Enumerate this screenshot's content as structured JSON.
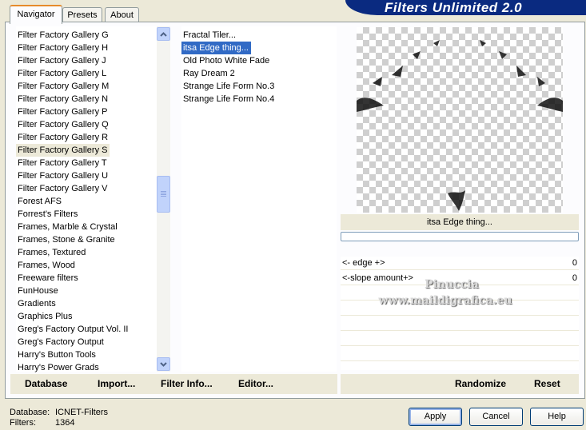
{
  "banner": {
    "title": "Filters Unlimited 2.0"
  },
  "tabs": [
    {
      "label": "Navigator",
      "active": true
    },
    {
      "label": "Presets",
      "active": false
    },
    {
      "label": "About",
      "active": false
    }
  ],
  "categories": {
    "items": [
      "Filter Factory Gallery G",
      "Filter Factory Gallery H",
      "Filter Factory Gallery J",
      "Filter Factory Gallery L",
      "Filter Factory Gallery M",
      "Filter Factory Gallery N",
      "Filter Factory Gallery P",
      "Filter Factory Gallery Q",
      "Filter Factory Gallery R",
      "Filter Factory Gallery S",
      "Filter Factory Gallery T",
      "Filter Factory Gallery U",
      "Filter Factory Gallery V",
      "Forest AFS",
      "Forrest's Filters",
      "Frames, Marble & Crystal",
      "Frames, Stone & Granite",
      "Frames, Textured",
      "Frames, Wood",
      "Freeware filters",
      "FunHouse",
      "Gradients",
      "Graphics Plus",
      "Greg's Factory Output Vol. II",
      "Greg's Factory Output",
      "Harry's Button Tools",
      "Harry's Power Grads"
    ],
    "selected_index": 9
  },
  "filters": {
    "items": [
      "Fractal Tiler...",
      "itsa Edge thing...",
      "Old Photo White Fade",
      "Ray Dream 2",
      "Strange Life Form No.3",
      "Strange Life Form No.4"
    ],
    "selected_index": 1
  },
  "preview": {
    "filter_name": "itsa Edge thing..."
  },
  "params": [
    {
      "label": "<- edge +>",
      "value": "0"
    },
    {
      "label": "<-slope amount+>",
      "value": "0"
    }
  ],
  "watermark": {
    "line1": "Pinuccia",
    "line2": "www.maildigrafica.eu"
  },
  "toolbar": {
    "database": "Database",
    "import": "Import...",
    "filter_info": "Filter Info...",
    "editor": "Editor...",
    "randomize": "Randomize",
    "reset": "Reset"
  },
  "status": {
    "database_label": "Database:",
    "database_value": "ICNET-Filters",
    "filters_label": "Filters:",
    "filters_value": "1364"
  },
  "buttons": {
    "apply": "Apply",
    "cancel": "Cancel",
    "help": "Help"
  }
}
